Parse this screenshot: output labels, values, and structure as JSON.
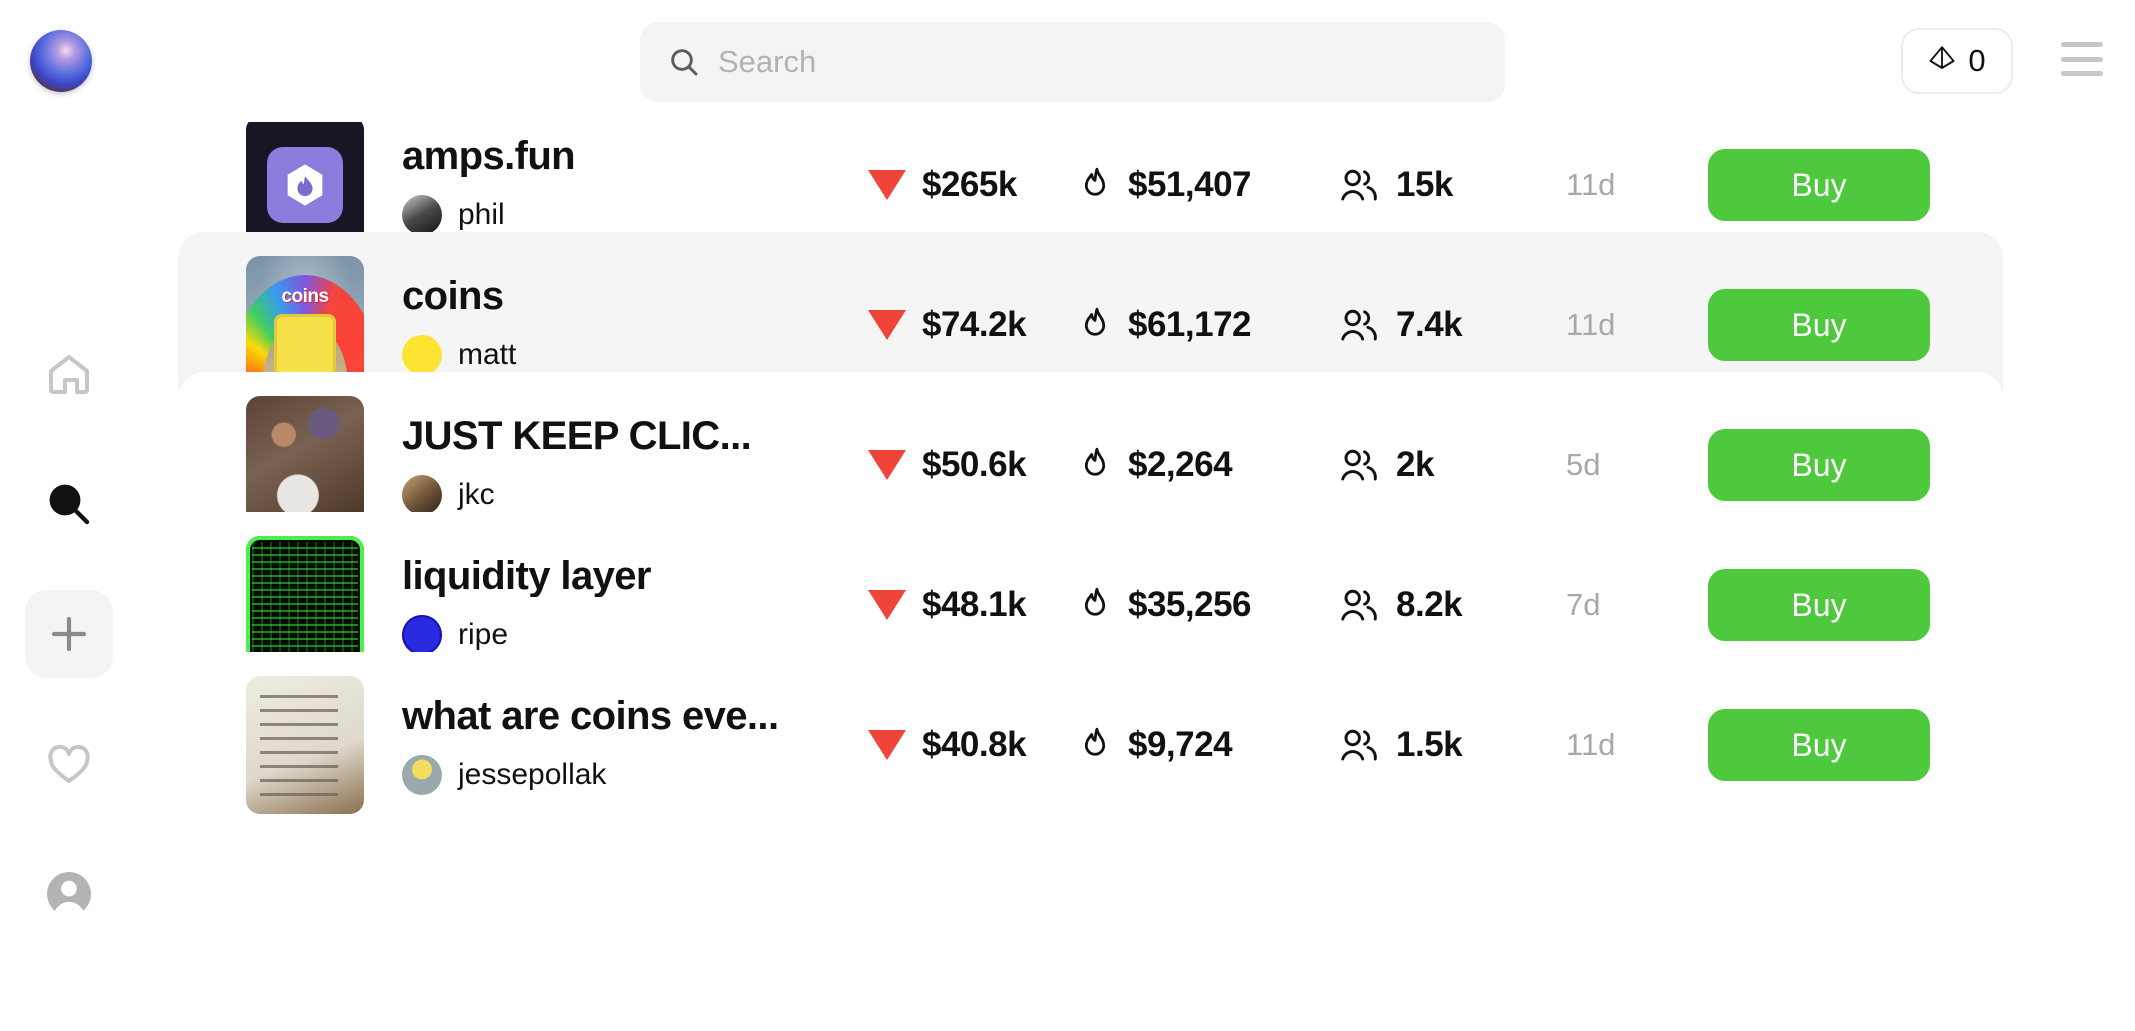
{
  "header": {
    "logo_icon": "sphere-logo",
    "search": {
      "icon": "search-icon",
      "placeholder": "Search",
      "value": ""
    },
    "wallet": {
      "icon": "ethereum-icon",
      "balance": "0"
    },
    "menu_icon": "hamburger-menu-icon"
  },
  "sidebar": {
    "items": [
      {
        "icon": "home-icon",
        "name": "home",
        "active": false,
        "boxed": false
      },
      {
        "icon": "search-icon",
        "name": "search",
        "active": true,
        "boxed": false
      },
      {
        "icon": "plus-icon",
        "name": "create",
        "active": false,
        "boxed": true
      },
      {
        "icon": "heart-icon",
        "name": "likes",
        "active": false,
        "boxed": false
      },
      {
        "icon": "avatar-icon",
        "name": "profile",
        "active": false,
        "boxed": false
      }
    ]
  },
  "list": {
    "buy_label": "Buy",
    "rows": [
      {
        "title": "amps.fun",
        "creator": "phil",
        "avatar_class": "av-phil",
        "thumb_class": "th-amps",
        "market_cap": "$265k",
        "market_cap_direction": "down",
        "volume": "$51,407",
        "holders": "15k",
        "age": "11d",
        "hover": false
      },
      {
        "title": "coins",
        "creator": "matt",
        "avatar_class": "av-matt",
        "thumb_class": "th-coins",
        "market_cap": "$74.2k",
        "market_cap_direction": "down",
        "volume": "$61,172",
        "holders": "7.4k",
        "age": "11d",
        "hover": true
      },
      {
        "title": "JUST KEEP CLIC...",
        "creator": "jkc",
        "avatar_class": "av-jkc",
        "thumb_class": "th-jkc",
        "market_cap": "$50.6k",
        "market_cap_direction": "down",
        "volume": "$2,264",
        "holders": "2k",
        "age": "5d",
        "hover": false
      },
      {
        "title": "liquidity layer",
        "creator": "ripe",
        "avatar_class": "av-ripe",
        "thumb_class": "th-liq",
        "market_cap": "$48.1k",
        "market_cap_direction": "down",
        "volume": "$35,256",
        "holders": "8.2k",
        "age": "7d",
        "hover": false
      },
      {
        "title": "what are coins eve...",
        "creator": "jessepollak",
        "avatar_class": "av-jesse",
        "thumb_class": "th-paper",
        "market_cap": "$40.8k",
        "market_cap_direction": "down",
        "volume": "$9,724",
        "holders": "1.5k",
        "age": "11d",
        "hover": false
      }
    ]
  },
  "colors": {
    "buy_green": "#4ec83c",
    "down_red": "#f04438",
    "hover_gray": "#f5f5f5",
    "muted_text": "#a8a8a8"
  }
}
